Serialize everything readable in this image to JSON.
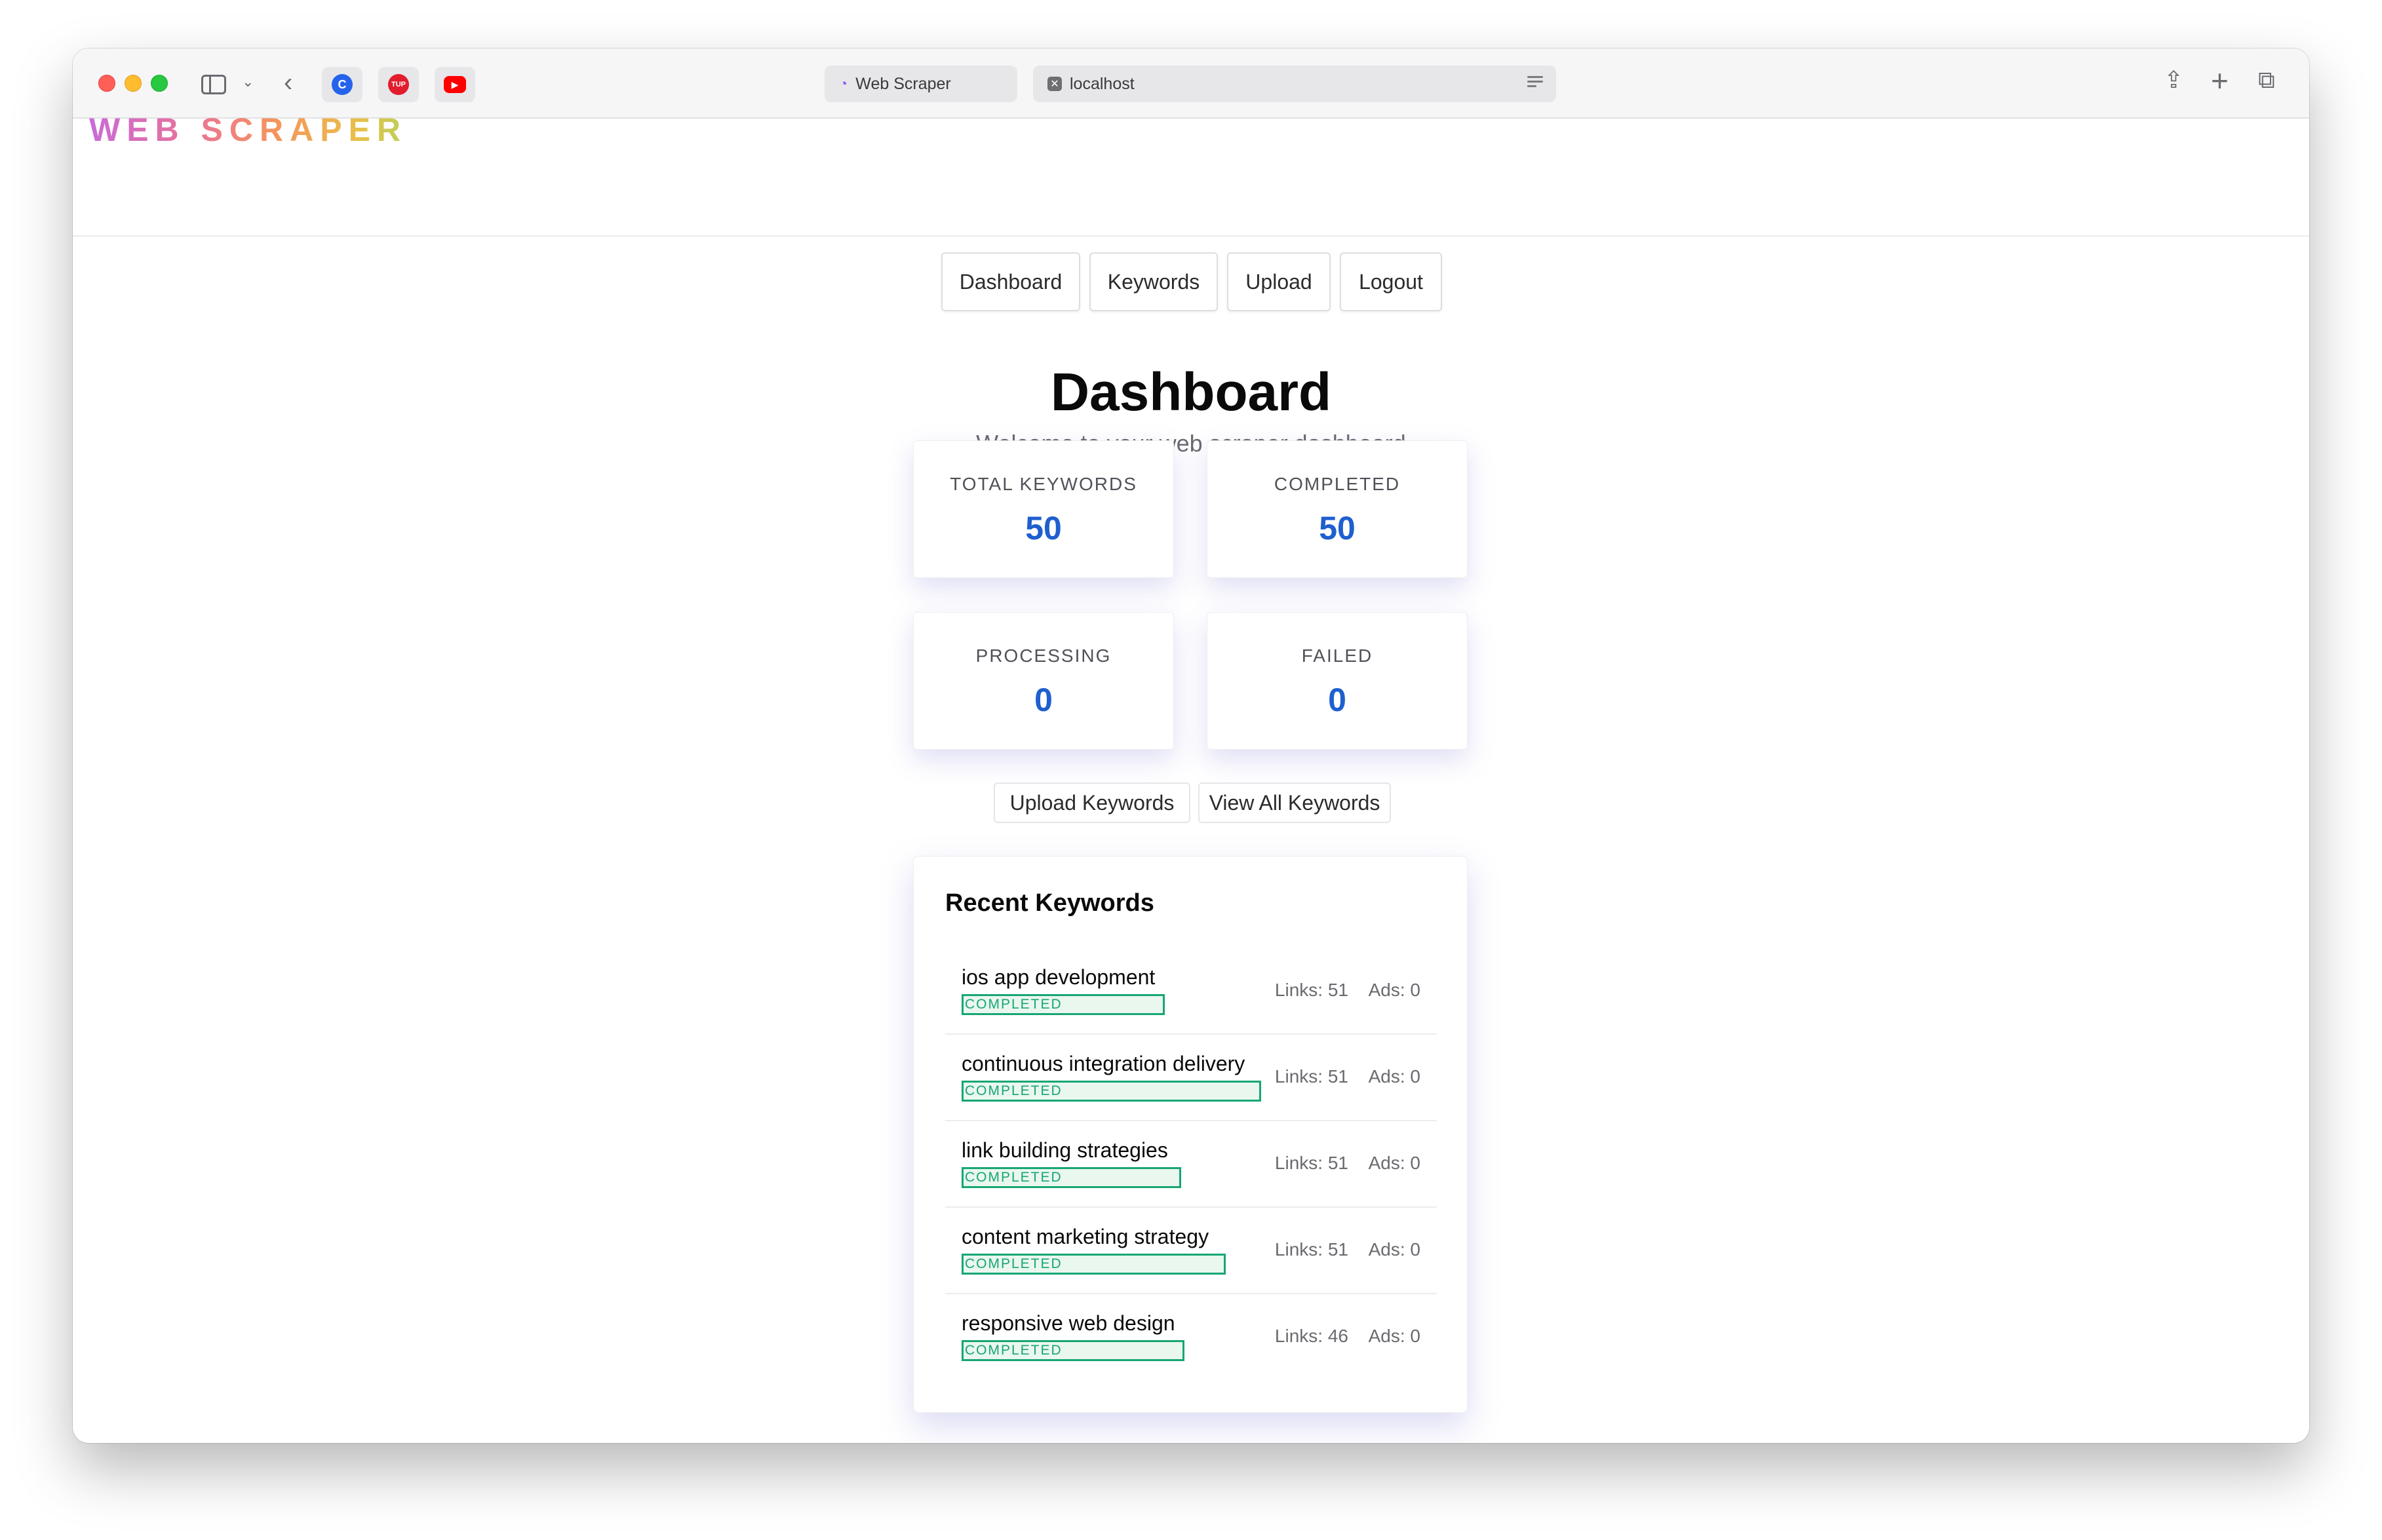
{
  "browser": {
    "tabs": [
      {
        "label": "Web Scraper",
        "icon": "spinner-icon"
      },
      {
        "label": "localhost",
        "icon": "close-tab-icon"
      }
    ],
    "favorites": [
      {
        "name": "c-favicon",
        "text": "C",
        "color": "#2563eb"
      },
      {
        "name": "tup-favicon",
        "text": "TUP",
        "color": "#e11d2e"
      },
      {
        "name": "youtube-favicon",
        "text": "▶",
        "color": "#ff0000"
      }
    ]
  },
  "app": {
    "logo": "WEB SCRAPER",
    "nav": [
      "Dashboard",
      "Keywords",
      "Upload",
      "Logout"
    ]
  },
  "page": {
    "title": "Dashboard",
    "subtitle": "Welcome to your web scraper dashboard"
  },
  "stats": {
    "total_label": "TOTAL KEYWORDS",
    "total": "50",
    "completed_label": "COMPLETED",
    "completed": "50",
    "processing_label": "PROCESSING",
    "processing": "0",
    "failed_label": "FAILED",
    "failed": "0"
  },
  "actions": {
    "upload": "Upload Keywords",
    "view_all": "View All Keywords"
  },
  "recent": {
    "title": "Recent Keywords",
    "items": [
      {
        "name": "ios app development",
        "status": "COMPLETED",
        "links": "Links: 51",
        "ads": "Ads: 0"
      },
      {
        "name": "continuous integration delivery",
        "status": "COMPLETED",
        "links": "Links: 51",
        "ads": "Ads: 0"
      },
      {
        "name": "link building strategies",
        "status": "COMPLETED",
        "links": "Links: 51",
        "ads": "Ads: 0"
      },
      {
        "name": "content marketing strategy",
        "status": "COMPLETED",
        "links": "Links: 51",
        "ads": "Ads: 0"
      },
      {
        "name": "responsive web design",
        "status": "COMPLETED",
        "links": "Links: 46",
        "ads": "Ads: 0"
      }
    ]
  },
  "colors": {
    "accent_blue": "#1f5fcf",
    "status_green": "#17a673"
  }
}
